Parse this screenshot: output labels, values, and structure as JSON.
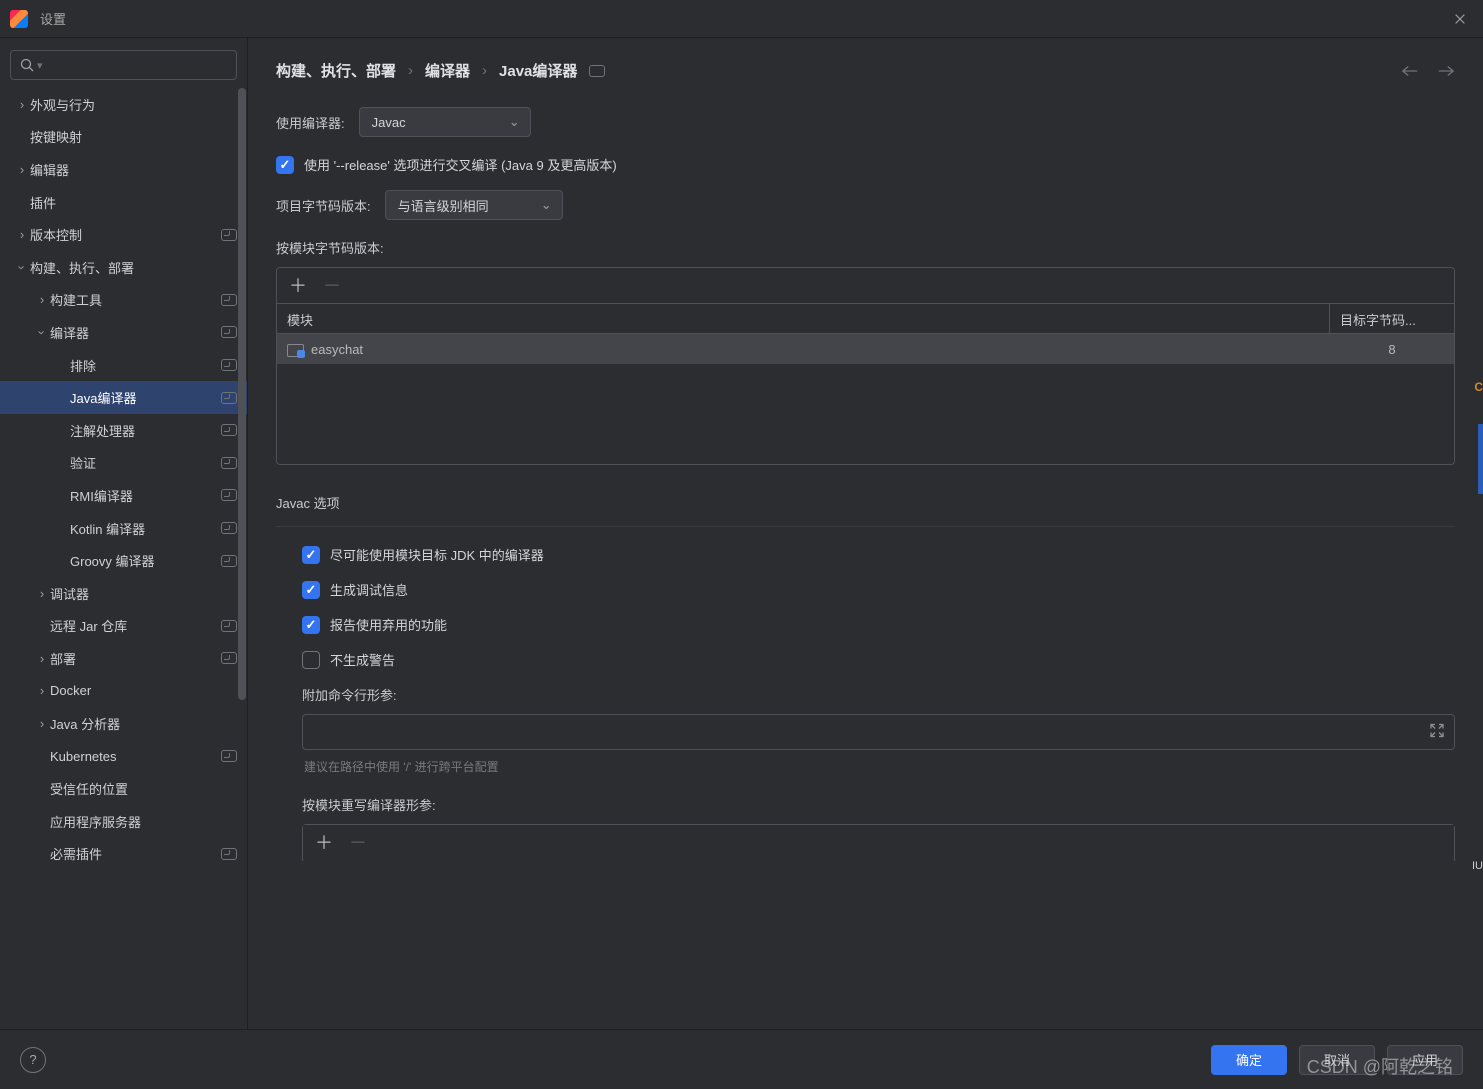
{
  "window": {
    "title": "设置"
  },
  "sidebar": {
    "items": [
      {
        "label": "外观与行为",
        "depth": 0,
        "chevron": "right",
        "badge": false
      },
      {
        "label": "按键映射",
        "depth": 0,
        "chevron": "",
        "badge": false
      },
      {
        "label": "编辑器",
        "depth": 0,
        "chevron": "right",
        "badge": false
      },
      {
        "label": "插件",
        "depth": 0,
        "chevron": "",
        "badge": false
      },
      {
        "label": "版本控制",
        "depth": 0,
        "chevron": "right",
        "badge": true
      },
      {
        "label": "构建、执行、部署",
        "depth": 0,
        "chevron": "down",
        "badge": false
      },
      {
        "label": "构建工具",
        "depth": 1,
        "chevron": "right",
        "badge": true
      },
      {
        "label": "编译器",
        "depth": 1,
        "chevron": "down",
        "badge": true
      },
      {
        "label": "排除",
        "depth": 2,
        "chevron": "",
        "badge": true
      },
      {
        "label": "Java编译器",
        "depth": 2,
        "chevron": "",
        "badge": true,
        "selected": true
      },
      {
        "label": "注解处理器",
        "depth": 2,
        "chevron": "",
        "badge": true
      },
      {
        "label": "验证",
        "depth": 2,
        "chevron": "",
        "badge": true
      },
      {
        "label": "RMI编译器",
        "depth": 2,
        "chevron": "",
        "badge": true
      },
      {
        "label": "Kotlin 编译器",
        "depth": 2,
        "chevron": "",
        "badge": true
      },
      {
        "label": "Groovy 编译器",
        "depth": 2,
        "chevron": "",
        "badge": true
      },
      {
        "label": "调试器",
        "depth": 1,
        "chevron": "right",
        "badge": false
      },
      {
        "label": "远程 Jar 仓库",
        "depth": 1,
        "chevron": "",
        "badge": true
      },
      {
        "label": "部署",
        "depth": 1,
        "chevron": "right",
        "badge": true
      },
      {
        "label": "Docker",
        "depth": 1,
        "chevron": "right",
        "badge": false
      },
      {
        "label": "Java 分析器",
        "depth": 1,
        "chevron": "right",
        "badge": false
      },
      {
        "label": "Kubernetes",
        "depth": 1,
        "chevron": "",
        "badge": true
      },
      {
        "label": "受信任的位置",
        "depth": 1,
        "chevron": "",
        "badge": false
      },
      {
        "label": "应用程序服务器",
        "depth": 1,
        "chevron": "",
        "badge": false
      },
      {
        "label": "必需插件",
        "depth": 1,
        "chevron": "",
        "badge": true
      }
    ]
  },
  "breadcrumb": {
    "parts": [
      "构建、执行、部署",
      "编译器",
      "Java编译器"
    ]
  },
  "form": {
    "use_compiler_label": "使用编译器:",
    "use_compiler_value": "Javac",
    "release_checkbox_label": "使用 '--release' 选项进行交叉编译 (Java 9 及更高版本)",
    "project_bytecode_label": "项目字节码版本:",
    "project_bytecode_value": "与语言级别相同",
    "per_module_label": "按模块字节码版本:",
    "table": {
      "col_module": "模块",
      "col_target": "目标字节码...",
      "rows": [
        {
          "module": "easychat",
          "target": "8"
        }
      ]
    },
    "javac_section_title": "Javac 选项",
    "javac_opts": {
      "use_module_jdk": "尽可能使用模块目标 JDK 中的编译器",
      "generate_debug": "生成调试信息",
      "report_deprecated": "报告使用弃用的功能",
      "no_warnings": "不生成警告"
    },
    "additional_args_label": "附加命令行形参:",
    "additional_args_hint": "建议在路径中使用 '/' 进行跨平台配置",
    "override_per_module_label": "按模块重写编译器形参:"
  },
  "footer": {
    "ok": "确定",
    "cancel": "取消",
    "apply": "应用"
  },
  "watermark": "CSDN @阿乾之铭"
}
